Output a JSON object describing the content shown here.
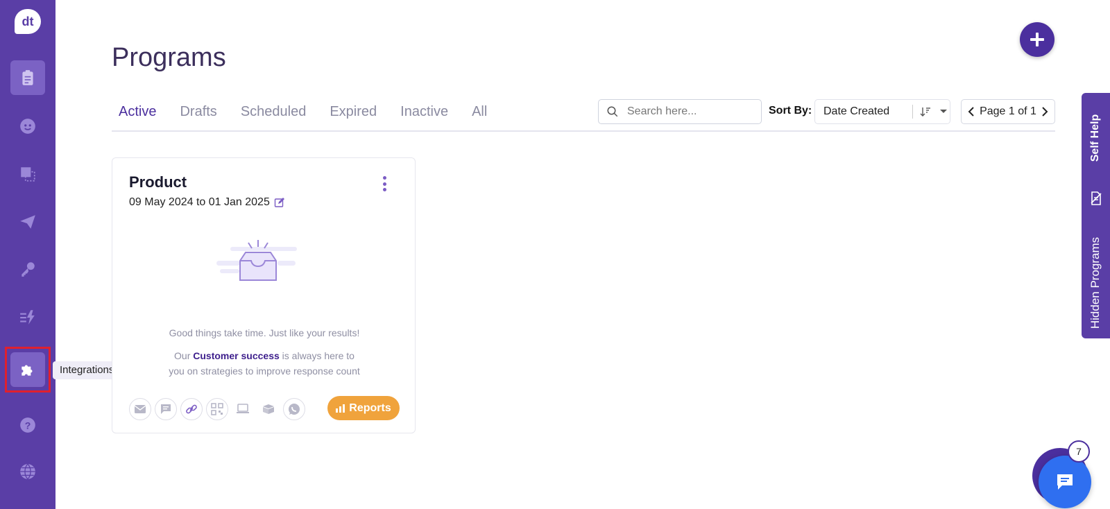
{
  "app": {
    "logo_text": "dt"
  },
  "header": {
    "title": "Programs"
  },
  "tabs": [
    {
      "label": "Active",
      "active": true
    },
    {
      "label": "Drafts"
    },
    {
      "label": "Scheduled"
    },
    {
      "label": "Expired"
    },
    {
      "label": "Inactive"
    },
    {
      "label": "All"
    }
  ],
  "search": {
    "placeholder": "Search here..."
  },
  "sort": {
    "label": "Sort By:",
    "value": "Date Created"
  },
  "pager": {
    "text": "Page 1 of 1"
  },
  "sidebar": {
    "tooltip": "Integrations",
    "items": [
      {
        "icon": "clipboard-icon",
        "active": true
      },
      {
        "icon": "smiley-icon"
      },
      {
        "icon": "squares-icon"
      },
      {
        "icon": "paper-plane-icon"
      },
      {
        "icon": "key-icon"
      },
      {
        "icon": "lightning-icon"
      },
      {
        "icon": "puzzle-icon",
        "active": true
      },
      {
        "icon": "help-icon"
      },
      {
        "icon": "globe-icon"
      }
    ]
  },
  "card": {
    "title": "Product",
    "date_start": "09 May 2024",
    "date_to": "to",
    "date_end": "01 Jan 2025",
    "message_line1": "Good things take time. Just like your results!",
    "message_prefix": "Our ",
    "message_link": "Customer success",
    "message_suffix": " is always here to",
    "message_line3": "you on strategies to improve response count",
    "reports_label": "Reports",
    "channels": [
      "email-icon",
      "sms-icon",
      "link-icon",
      "qr-icon",
      "laptop-icon",
      "box-icon",
      "whatsapp-icon"
    ]
  },
  "side_panel": {
    "self_help": "Self Help",
    "hidden_programs": "Hidden Programs"
  },
  "chat": {
    "badge": "7"
  },
  "colors": {
    "primary": "#5a3ea6",
    "accent": "#4b2f9e",
    "reports": "#f0a33c",
    "highlight": "#e0202e"
  }
}
